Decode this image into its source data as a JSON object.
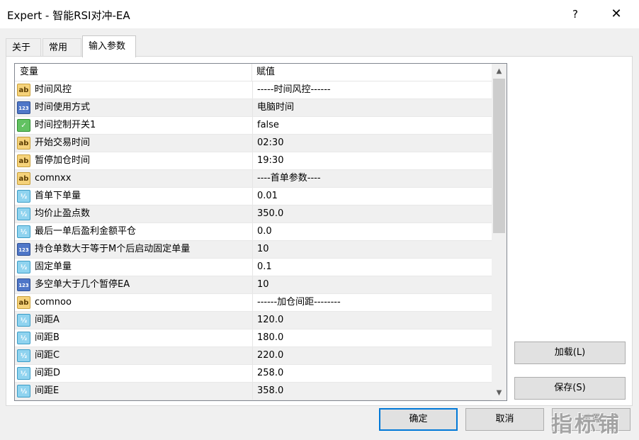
{
  "window": {
    "title": "Expert - 智能RSI对冲-EA",
    "help_label": "?",
    "close_label": "✕"
  },
  "tabs": [
    {
      "label": "关于"
    },
    {
      "label": "常用"
    },
    {
      "label": "输入参数"
    }
  ],
  "grid": {
    "headers": {
      "variable": "变量",
      "value": "赋值"
    },
    "rows": [
      {
        "icon": "ab",
        "name": "时间风控",
        "value": "-----时间风控------"
      },
      {
        "icon": "123",
        "name": "时间使用方式",
        "value": "电脑时间"
      },
      {
        "icon": "bool",
        "name": "时间控制开关1",
        "value": "false"
      },
      {
        "icon": "ab",
        "name": "开始交易时间",
        "value": "02:30"
      },
      {
        "icon": "ab",
        "name": "暂停加仓时间",
        "value": "19:30"
      },
      {
        "icon": "ab",
        "name": "comnxx",
        "value": "----首单参数----"
      },
      {
        "icon": "half",
        "name": "首单下单量",
        "value": "0.01"
      },
      {
        "icon": "half",
        "name": "均价止盈点数",
        "value": "350.0"
      },
      {
        "icon": "half",
        "name": "最后一单后盈利金额平仓",
        "value": "0.0"
      },
      {
        "icon": "123",
        "name": "持仓单数大于等于M个后启动固定单量",
        "value": "10"
      },
      {
        "icon": "half",
        "name": "固定单量",
        "value": "0.1"
      },
      {
        "icon": "123",
        "name": "多空单大于几个暂停EA",
        "value": "10"
      },
      {
        "icon": "ab",
        "name": "comnoo",
        "value": "------加仓间距--------"
      },
      {
        "icon": "half",
        "name": "间距A",
        "value": "120.0"
      },
      {
        "icon": "half",
        "name": "间距B",
        "value": "180.0"
      },
      {
        "icon": "half",
        "name": "间距C",
        "value": "220.0"
      },
      {
        "icon": "half",
        "name": "间距D",
        "value": "258.0"
      },
      {
        "icon": "half",
        "name": "间距E",
        "value": "358.0"
      }
    ]
  },
  "icon_glyphs": {
    "ab": "ab",
    "123": "123",
    "half": "½",
    "bool": "✓"
  },
  "buttons": {
    "load": "加载(L)",
    "save": "保存(S)",
    "ok": "确定",
    "cancel": "取消",
    "reset": "重置"
  },
  "watermark": "指标铺"
}
